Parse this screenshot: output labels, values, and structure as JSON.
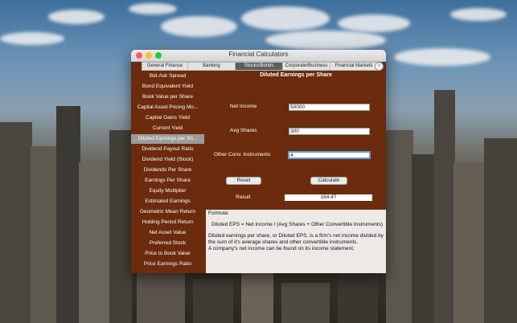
{
  "window": {
    "title": "Financial Calculators"
  },
  "tabs": [
    {
      "label": "General Finance"
    },
    {
      "label": "Banking"
    },
    {
      "label": "Stocks/Bonds"
    },
    {
      "label": "Corporate/Business"
    },
    {
      "label": "Financial Markets"
    }
  ],
  "active_tab": "Stocks/Bonds",
  "sidebar": {
    "items": [
      {
        "label": "Bid-Ask Spread"
      },
      {
        "label": "Bond Equivalent Yield"
      },
      {
        "label": "Book Value per Share"
      },
      {
        "label": "Capital Asset Pricing Mo..."
      },
      {
        "label": "Capital Gains Yield"
      },
      {
        "label": "Current Yield"
      },
      {
        "label": "Diluted Earnings per Sh..."
      },
      {
        "label": "Dividend Payout Ratio"
      },
      {
        "label": "Dividend Yield (Stock)"
      },
      {
        "label": "Dividends Per Share"
      },
      {
        "label": "Earnings Per Share"
      },
      {
        "label": "Equity Multiplier"
      },
      {
        "label": "Estimated Earnings"
      },
      {
        "label": "Geometric Mean Return"
      },
      {
        "label": "Holding Period Return"
      },
      {
        "label": "Net Asset Value"
      },
      {
        "label": "Preferred Stock"
      },
      {
        "label": "Price to Book Value"
      },
      {
        "label": "Price Earnings Ratio"
      }
    ],
    "selected": "Diluted Earnings per Sh..."
  },
  "calculator": {
    "heading": "Diluted Earnings per Share",
    "net_income_label": "Net Income",
    "net_income_value": "50000",
    "avg_shares_label": "Avg Shares",
    "avg_shares_value": "300",
    "other_conv_label": "Other Conv. Instruments",
    "other_conv_value": "4",
    "reset_label": "Reset",
    "calculate_label": "Calculate",
    "result_label": "Result",
    "result_value": "164.47"
  },
  "formula": {
    "title": "Formula:",
    "equation": "Diluted EPS = Net Income / (Avg Shares + Other Convertible Instruments)",
    "description": "Diluted earnings per share, or Diluted EPS, is a firm's net income divided by the sum of it's average shares and other convertible instruments.",
    "note": "A company's net income can be found on its income statement."
  },
  "colors": {
    "window_bg": "#6b2b0c",
    "selected_bg": "#9b9b9b",
    "focus_ring": "#5aa0e6"
  }
}
